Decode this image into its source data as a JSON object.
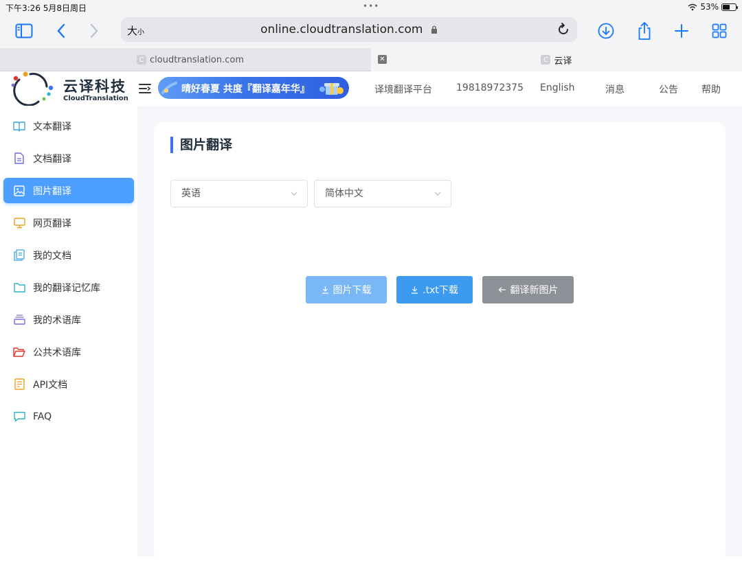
{
  "status": {
    "time": "下午3:26  5月8日周日",
    "battery": "53%",
    "battery_level": 0.53
  },
  "browser": {
    "text_size": "大",
    "text_size_small": "小",
    "url": "online.cloudtranslation.com",
    "tabs": [
      {
        "title": "cloudtranslation.com",
        "favicon": "C",
        "active": false
      },
      {
        "title": "云译",
        "favicon": "C",
        "active": true
      }
    ]
  },
  "header": {
    "brand_cn": "云译科技",
    "brand_en": "CloudTranslation",
    "banner_text": "晴好春夏 共度『翻译嘉年华』",
    "nav": [
      "译境翻译平台",
      "19818972375",
      "English",
      "消息",
      "公告",
      "帮助"
    ]
  },
  "sidebar": {
    "items": [
      {
        "label": "文本翻译",
        "icon": "book-icon",
        "color": "#3ba6e0"
      },
      {
        "label": "文档翻译",
        "icon": "document-icon",
        "color": "#6d68d8"
      },
      {
        "label": "图片翻译",
        "icon": "image-icon",
        "color": "#ffffff",
        "active": true
      },
      {
        "label": "网页翻译",
        "icon": "monitor-icon",
        "color": "#f0a020"
      },
      {
        "label": "我的文档",
        "icon": "files-icon",
        "color": "#3ba6e0"
      },
      {
        "label": "我的翻译记忆库",
        "icon": "folder-icon",
        "color": "#2bb4c8"
      },
      {
        "label": "我的术语库",
        "icon": "stack-icon",
        "color": "#7b6fd8"
      },
      {
        "label": "公共术语库",
        "icon": "folder-open-icon",
        "color": "#e0322e"
      },
      {
        "label": "API文档",
        "icon": "api-doc-icon",
        "color": "#f0a020"
      },
      {
        "label": "FAQ",
        "icon": "chat-icon",
        "color": "#2bb4c8"
      }
    ]
  },
  "main": {
    "title": "图片翻译",
    "source_lang": "英语",
    "target_lang": "简体中文",
    "buttons": {
      "download_image": "图片下载",
      "download_txt": ".txt下载",
      "new_image": "翻译新图片"
    }
  },
  "colors": {
    "accent": "#4c9eff",
    "title_bar": "#3a72f0",
    "browser_blue": "#1677ff"
  }
}
